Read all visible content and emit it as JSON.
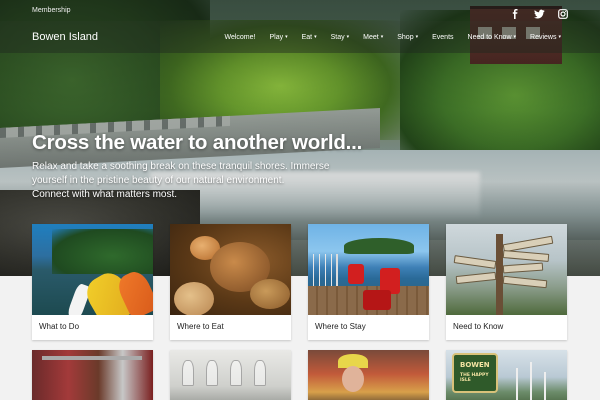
{
  "topbar": {
    "membership_label": "Membership",
    "social": [
      {
        "name": "facebook-icon"
      },
      {
        "name": "twitter-icon"
      },
      {
        "name": "instagram-icon"
      }
    ]
  },
  "nav": {
    "brand": "Bowen Island",
    "items": [
      {
        "label": "Welcome!",
        "has_caret": false
      },
      {
        "label": "Play",
        "has_caret": true
      },
      {
        "label": "Eat",
        "has_caret": true
      },
      {
        "label": "Stay",
        "has_caret": true
      },
      {
        "label": "Meet",
        "has_caret": true
      },
      {
        "label": "Shop",
        "has_caret": true
      },
      {
        "label": "Events",
        "has_caret": false
      },
      {
        "label": "Need to Know",
        "has_caret": true
      },
      {
        "label": "Reviews",
        "has_caret": true
      }
    ]
  },
  "hero": {
    "title": "Cross the water to another world...",
    "subtitle_lines": [
      "Relax and take a soothing break on these tranquil shores. Immerse",
      "yourself in the pristine beauty of our natural environment.",
      "Connect with what matters most."
    ]
  },
  "cards": [
    {
      "label": "What to Do"
    },
    {
      "label": "Where to Eat"
    },
    {
      "label": "Where to Stay"
    },
    {
      "label": "Need to Know"
    }
  ],
  "row2": {
    "sign_text": [
      "BOWEN",
      "THE HAPPY ISLE"
    ]
  },
  "colors": {
    "nav_overlay": "#1e281e",
    "card_bg": "#ffffff",
    "page_bg": "#f2f2f2"
  }
}
